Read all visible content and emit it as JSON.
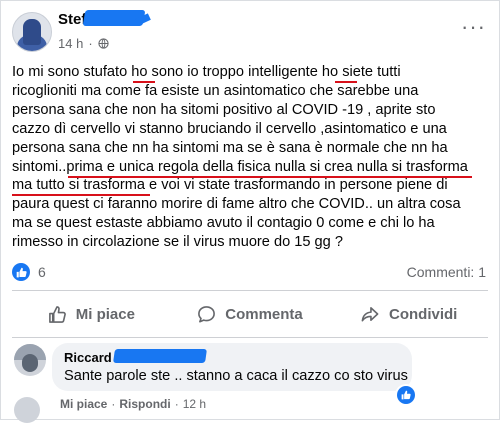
{
  "post": {
    "author": "Stef",
    "timestamp": "14 h",
    "audience_icon": "globe-icon",
    "more_icon": "more-options-icon",
    "text_lines": [
      "Io mi sono stufato ho sono io troppo intelligente ho siete tutti",
      "ricoglioniti ma come fa esiste un asintomatico che sarebbe una",
      "persona sana che non ha sitomi positivo al COVID -19 , aprite sto",
      "cazzo dì cervello vi stanno bruciando il cervello ,asintomatico e una",
      "persona sana che nn ha sintomi ma se è sana è normale che nn ha",
      "sintomi..prima e unica regola della fisica nulla si crea nulla si trasforma",
      "ma tutto si trasforma e voi vi state trasformando in persone piene di",
      "paura quest ci faranno morire di fame altro che COVID.. un altra cosa",
      "ma se quest estaste abbiamo avuto il contagio 0 come e chi lo ha",
      "rimesso in circolazione se il virus muore do 15 gg ?"
    ]
  },
  "reactions": {
    "icon": "like-icon",
    "count": "6",
    "comments": "Commenti: 1"
  },
  "actions": [
    {
      "label": "Mi piace",
      "icon": "like-icon"
    },
    {
      "label": "Commenta",
      "icon": "comment-icon"
    },
    {
      "label": "Condividi",
      "icon": "share-icon"
    }
  ],
  "comment": {
    "author": "Riccard",
    "text": "Sante parole ste .. stanno a caca il cazzo co sto virus",
    "like_label": "Mi piace",
    "separator": "·",
    "reply_label": "Rispondi",
    "timestamp": "12 h"
  },
  "colors": {
    "facebook_blue": "#1877f2",
    "underline_red": "#d8101a",
    "secondary_text": "#65676b"
  }
}
